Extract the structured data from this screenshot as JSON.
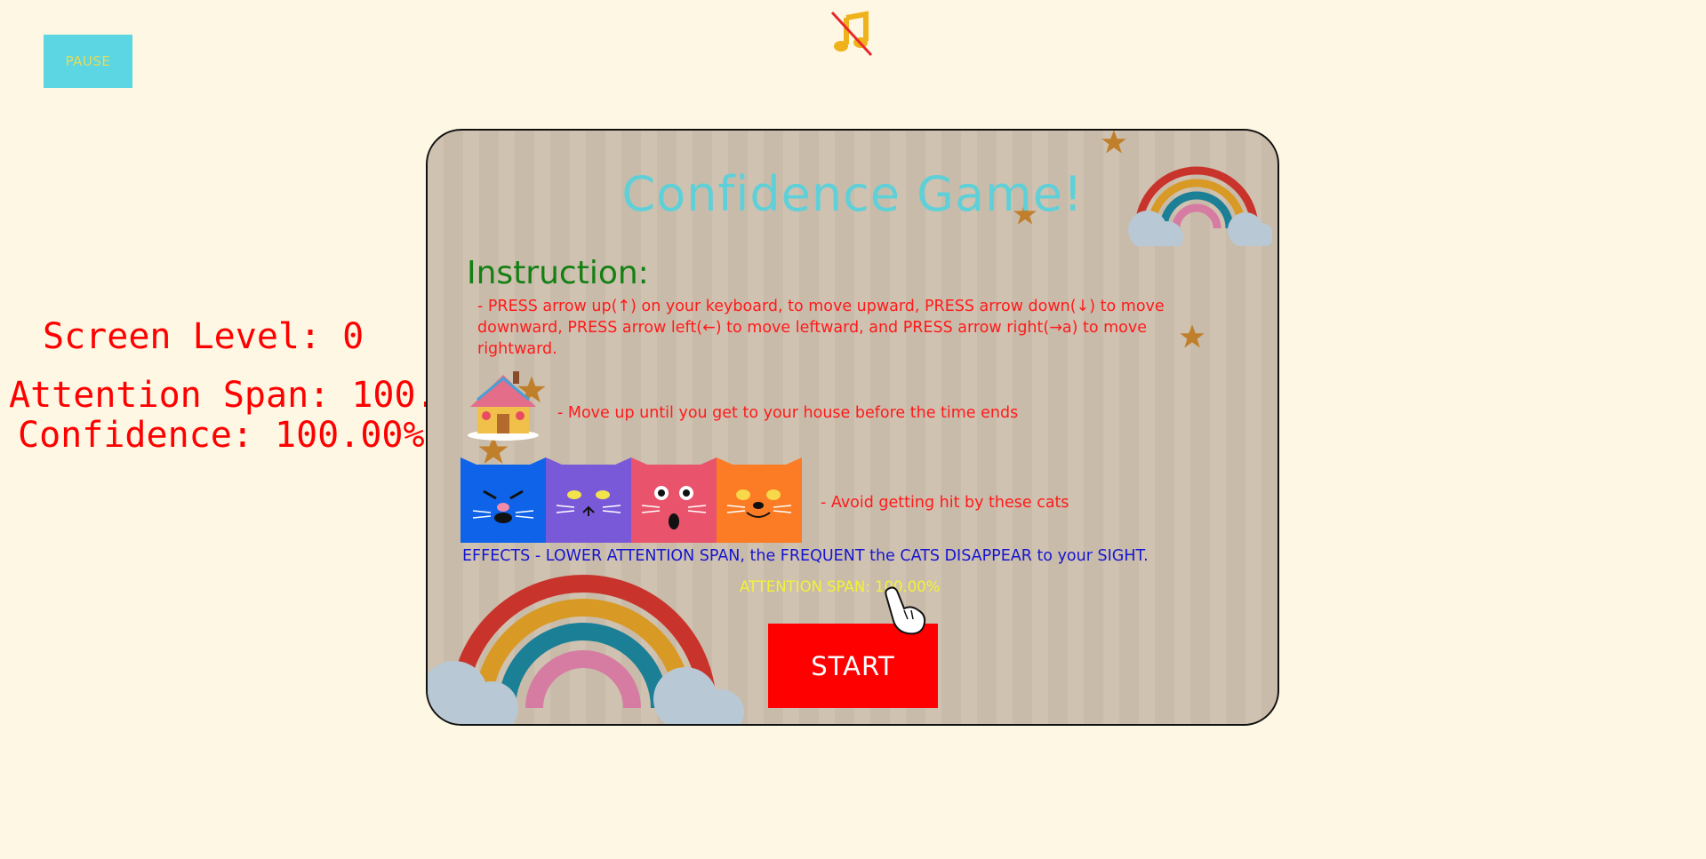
{
  "pause_label": "PAUSE",
  "music_icon": "music-muted-icon",
  "hud": {
    "level": "Screen Level: 0",
    "attention": "Attention Span: 100.",
    "confidence": "Confidence: 100.00%"
  },
  "panel": {
    "title": "Confidence Game!",
    "instruction_heading": "Instruction:",
    "instruction_text": " - PRESS arrow up(↑) on your keyboard, to move upward, PRESS arrow down(↓) to move downward, PRESS arrow left(←) to move leftward, and PRESS arrow right(→a) to move rightward.",
    "house_text": "- Move up until you get to your house before the time ends",
    "cats_text": "- Avoid getting hit by these cats",
    "effects_text": "EFFECTS - LOWER ATTENTION SPAN, the FREQUENT the CATS DISAPPEAR to your SIGHT.",
    "attention_line": "ATTENTION SPAN: 100.00%",
    "start_label": "START"
  },
  "colors": {
    "background": "#fef7e3",
    "pause_bg": "#5bd6e2",
    "hud_text": "#ff0000",
    "title": "#5fd0d8",
    "instruction_heading": "#138013",
    "effects": "#1515d0",
    "start_bg": "#ff0000",
    "cat_blue": "#0f63e8",
    "cat_purple": "#7a59d9",
    "cat_pink": "#e9546c",
    "cat_orange": "#fb7c24"
  }
}
